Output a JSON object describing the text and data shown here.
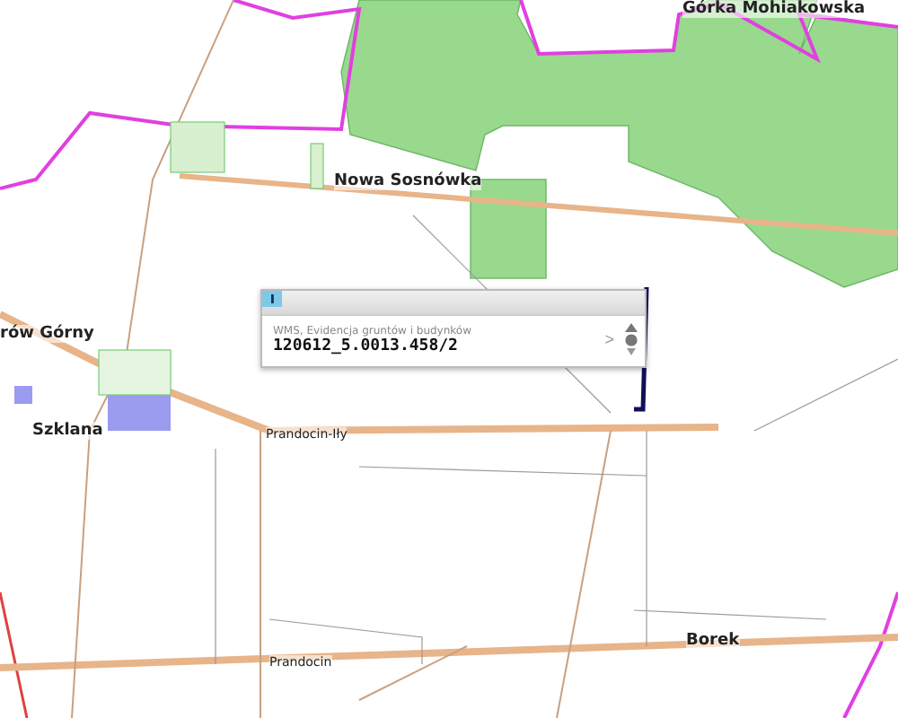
{
  "map": {
    "labels": [
      {
        "text": "Górka Mohiakowska"
      },
      {
        "text": "Nowa Sosnówka"
      },
      {
        "text": "rów Górny"
      },
      {
        "text": "Szklana"
      },
      {
        "text": "Prandocin-Iły",
        "kind": "small"
      },
      {
        "text": "Prandocin",
        "kind": "small"
      },
      {
        "text": "Borek"
      }
    ]
  },
  "popup": {
    "source": "WMS, Evidencja gruntów i budynków",
    "parcel_id": "120612_5.0013.458/2",
    "next": ">"
  }
}
